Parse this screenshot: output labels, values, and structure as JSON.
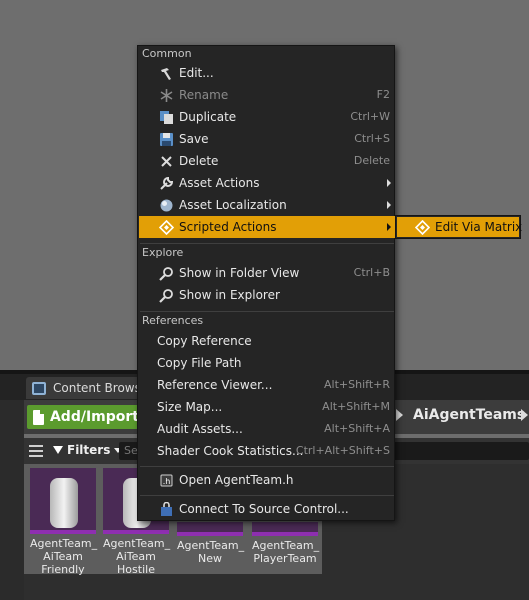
{
  "content_browser": {
    "tab_label": "Content Browser",
    "add_import_label": "Add/Import",
    "path_label": "AiAgentTeams",
    "filters_label": "Filters",
    "search_placeholder": "Se",
    "assets": [
      {
        "name": "AgentTeam_\nAiTeam\nFriendly"
      },
      {
        "name": "AgentTeam_\nAiTeam\nHostile"
      },
      {
        "name": "AgentTeam_\nNew"
      },
      {
        "name": "AgentTeam_\nPlayerTeam"
      }
    ]
  },
  "context_menu": {
    "sections": {
      "common": "Common",
      "explore": "Explore",
      "references": "References"
    },
    "items": {
      "edit": {
        "label": "Edit...",
        "icon": "hammer-icon"
      },
      "rename": {
        "label": "Rename",
        "shortcut": "F2",
        "icon": "rename-icon",
        "disabled": true
      },
      "duplicate": {
        "label": "Duplicate",
        "shortcut": "Ctrl+W",
        "icon": "duplicate-icon"
      },
      "save": {
        "label": "Save",
        "shortcut": "Ctrl+S",
        "icon": "save-icon"
      },
      "delete": {
        "label": "Delete",
        "shortcut": "Delete",
        "icon": "delete-icon"
      },
      "asset_actions": {
        "label": "Asset Actions",
        "icon": "wrench-icon"
      },
      "asset_localization": {
        "label": "Asset Localization",
        "icon": "globe-icon"
      },
      "scripted_actions": {
        "label": "Scripted Actions",
        "icon": "scripted-action-icon",
        "highlighted": true
      },
      "show_in_folder_view": {
        "label": "Show in Folder View",
        "shortcut": "Ctrl+B",
        "icon": "magnifier-icon"
      },
      "show_in_explorer": {
        "label": "Show in Explorer",
        "icon": "magnifier-icon"
      },
      "copy_reference": {
        "label": "Copy Reference"
      },
      "copy_file_path": {
        "label": "Copy File Path"
      },
      "reference_viewer": {
        "label": "Reference Viewer...",
        "shortcut": "Alt+Shift+R"
      },
      "size_map": {
        "label": "Size Map...",
        "shortcut": "Alt+Shift+M"
      },
      "audit_assets": {
        "label": "Audit Assets...",
        "shortcut": "Alt+Shift+A"
      },
      "shader_cook_statistics": {
        "label": "Shader Cook Statistics...",
        "shortcut": "Ctrl+Alt+Shift+S"
      },
      "open_header": {
        "label": "Open AgentTeam.h",
        "icon": "header-file-icon"
      },
      "connect_source_control": {
        "label": "Connect To Source Control...",
        "icon": "source-control-icon"
      }
    }
  },
  "submenu": {
    "edit_via_matrix": {
      "label": "Edit Via Matrix",
      "icon": "scripted-action-icon"
    }
  },
  "colors": {
    "highlight": "#e29f06",
    "menu_bg": "#252525",
    "add_import_green": "#5b9b2e",
    "asset_purple": "#8e2fb0"
  }
}
